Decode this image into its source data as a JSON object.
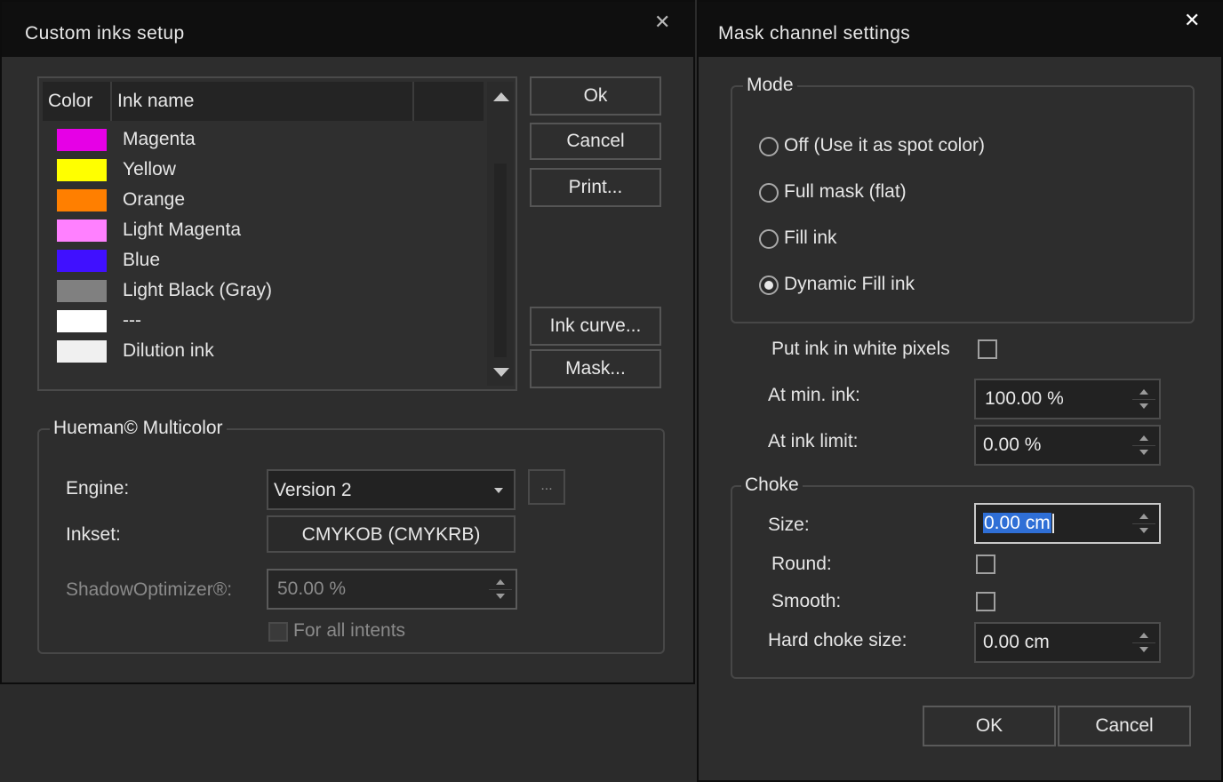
{
  "inks_dialog": {
    "title": "Custom inks setup",
    "columns": [
      "Color",
      "Ink name",
      ""
    ],
    "inks": [
      {
        "color": "#e600e6",
        "name": "Magenta"
      },
      {
        "color": "#ffff00",
        "name": "Yellow"
      },
      {
        "color": "#ff7f00",
        "name": "Orange"
      },
      {
        "color": "#ff80ff",
        "name": "Light Magenta"
      },
      {
        "color": "#4010ff",
        "name": "Blue"
      },
      {
        "color": "#808080",
        "name": "Light Black (Gray)"
      },
      {
        "color": "#ffffff",
        "name": "---"
      },
      {
        "color": "#f0f0f0",
        "name": "Dilution ink"
      }
    ],
    "buttons": {
      "ok": "Ok",
      "cancel": "Cancel",
      "print": "Print...",
      "ink_curve": "Ink curve...",
      "mask": "Mask..."
    },
    "multicolor": {
      "title": "Hueman© Multicolor",
      "engine_label": "Engine:",
      "engine_value": "Version 2",
      "engine_more": "...",
      "inkset_label": "Inkset:",
      "inkset_value": "CMYKOB (CMYKRB)",
      "shadow_label": "ShadowOptimizer®:",
      "shadow_value": "50.00 %",
      "for_all_intents": "For all intents"
    }
  },
  "mask_dialog": {
    "title": "Mask channel settings",
    "mode_title": "Mode",
    "modes": [
      {
        "label": "Off (Use it as spot color)",
        "selected": false
      },
      {
        "label": "Full mask (flat)",
        "selected": false
      },
      {
        "label": "Fill ink",
        "selected": false
      },
      {
        "label": "Dynamic Fill ink",
        "selected": true
      }
    ],
    "white_pixels_label": "Put ink in white pixels",
    "min_ink_label": "At min. ink:",
    "min_ink_value": "100.00 %",
    "ink_limit_label": "At ink limit:",
    "ink_limit_value": "0.00 %",
    "choke": {
      "title": "Choke",
      "size_label": "Size:",
      "size_value": "0.00 cm",
      "round_label": "Round:",
      "smooth_label": "Smooth:",
      "hard_label": "Hard choke size:",
      "hard_value": "0.00 cm"
    },
    "ok": "OK",
    "cancel": "Cancel"
  }
}
